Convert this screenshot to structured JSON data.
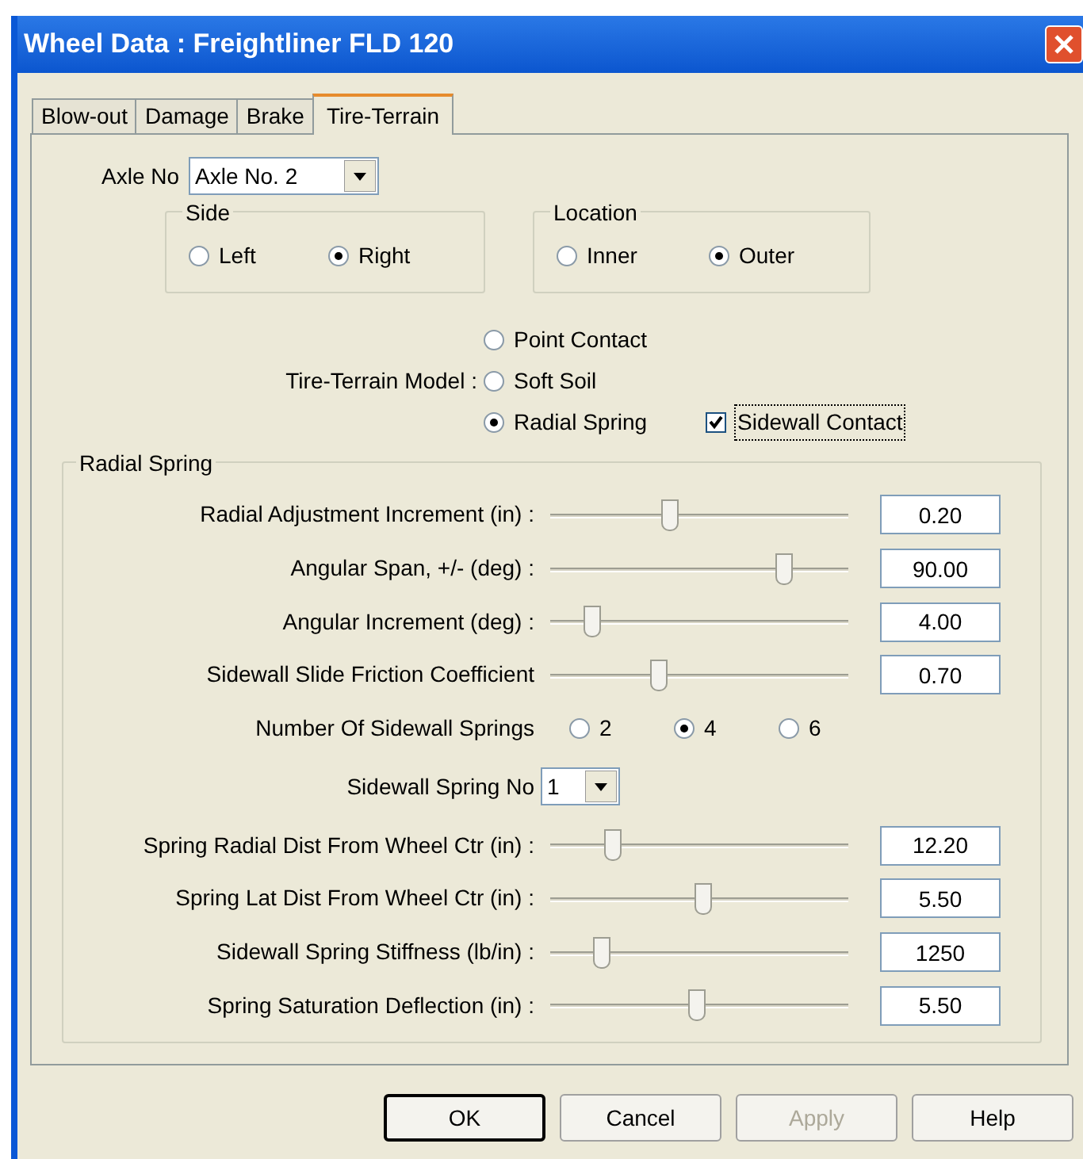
{
  "window": {
    "title": "Wheel Data : Freightliner FLD 120"
  },
  "tabs": [
    {
      "label": "Blow-out",
      "selected": false
    },
    {
      "label": "Damage",
      "selected": false
    },
    {
      "label": "Brake",
      "selected": false
    },
    {
      "label": "Tire-Terrain",
      "selected": true
    }
  ],
  "axle": {
    "label": "Axle No",
    "value": "Axle No. 2"
  },
  "side": {
    "title": "Side",
    "options": [
      {
        "label": "Left",
        "selected": false
      },
      {
        "label": "Right",
        "selected": true
      }
    ]
  },
  "location": {
    "title": "Location",
    "options": [
      {
        "label": "Inner",
        "selected": false
      },
      {
        "label": "Outer",
        "selected": true
      }
    ]
  },
  "model": {
    "label": "Tire-Terrain Model :",
    "options": [
      {
        "label": "Point Contact",
        "selected": false
      },
      {
        "label": "Soft Soil",
        "selected": false
      },
      {
        "label": "Radial Spring",
        "selected": true
      }
    ],
    "sidewall_contact": {
      "label": "Sidewall Contact",
      "checked": true
    }
  },
  "radial_spring": {
    "title": "Radial Spring",
    "rows": [
      {
        "kind": "slider",
        "label": "Radial Adjustment Increment (in) :",
        "level": 0.4,
        "value": "0.20"
      },
      {
        "kind": "slider",
        "label": "Angular Span, +/- (deg) :",
        "level": 0.78,
        "value": "90.00"
      },
      {
        "kind": "slider",
        "label": "Angular Increment (deg) :",
        "level": 0.14,
        "value": "4.00"
      },
      {
        "kind": "slider",
        "label": "Sidewall Slide Friction Coefficient",
        "level": 0.36,
        "value": "0.70"
      },
      {
        "kind": "radio",
        "label": "Number Of Sidewall Springs",
        "options": [
          {
            "label": "2",
            "selected": false
          },
          {
            "label": "4",
            "selected": true
          },
          {
            "label": "6",
            "selected": false
          }
        ]
      },
      {
        "kind": "dropdown",
        "label": "Sidewall Spring No",
        "value": "1"
      },
      {
        "kind": "slider",
        "label": "Spring Radial Dist From Wheel Ctr (in) :",
        "level": 0.21,
        "value": "12.20"
      },
      {
        "kind": "slider",
        "label": "Spring Lat Dist From Wheel Ctr (in) :",
        "level": 0.51,
        "value": "5.50"
      },
      {
        "kind": "slider",
        "label": "Sidewall Spring Stiffness (lb/in) :",
        "level": 0.17,
        "value": "1250"
      },
      {
        "kind": "slider",
        "label": "Spring Saturation Deflection (in) :",
        "level": 0.49,
        "value": "5.50"
      }
    ]
  },
  "buttons": [
    {
      "label": "OK",
      "disabled": false
    },
    {
      "label": "Cancel",
      "disabled": false
    },
    {
      "label": "Apply",
      "disabled": true
    },
    {
      "label": "Help",
      "disabled": false
    }
  ]
}
